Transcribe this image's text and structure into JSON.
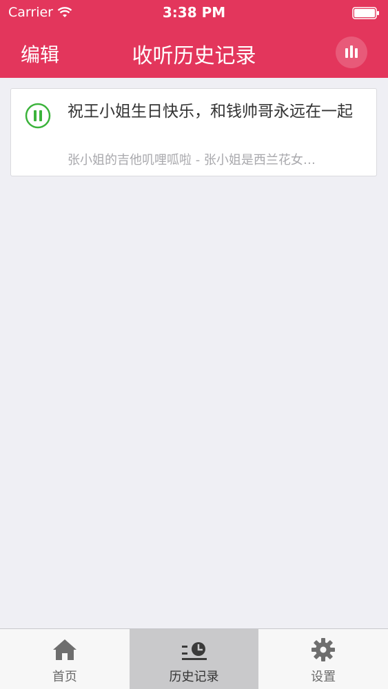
{
  "status_bar": {
    "carrier": "Carrier",
    "time": "3:38 PM",
    "wifi_icon": "wifi-icon",
    "battery_icon": "battery-icon"
  },
  "navbar": {
    "edit_label": "编辑",
    "title": "收听历史记录",
    "now_playing_icon": "equalizer-bars-icon",
    "color": "#e3365c"
  },
  "history": [
    {
      "title": "祝王小姐生日快乐，和钱帅哥永远在一起",
      "subtitle": "张小姐的吉他叽哩呱啦 - 张小姐是西兰花女…",
      "state_icon": "pause-icon",
      "state_color": "#3bb33b"
    }
  ],
  "tabbar": {
    "tabs": [
      {
        "label": "首页",
        "icon": "home-icon",
        "active": false
      },
      {
        "label": "历史记录",
        "icon": "history-clock-icon",
        "active": true
      },
      {
        "label": "设置",
        "icon": "gear-icon",
        "active": false
      }
    ]
  }
}
